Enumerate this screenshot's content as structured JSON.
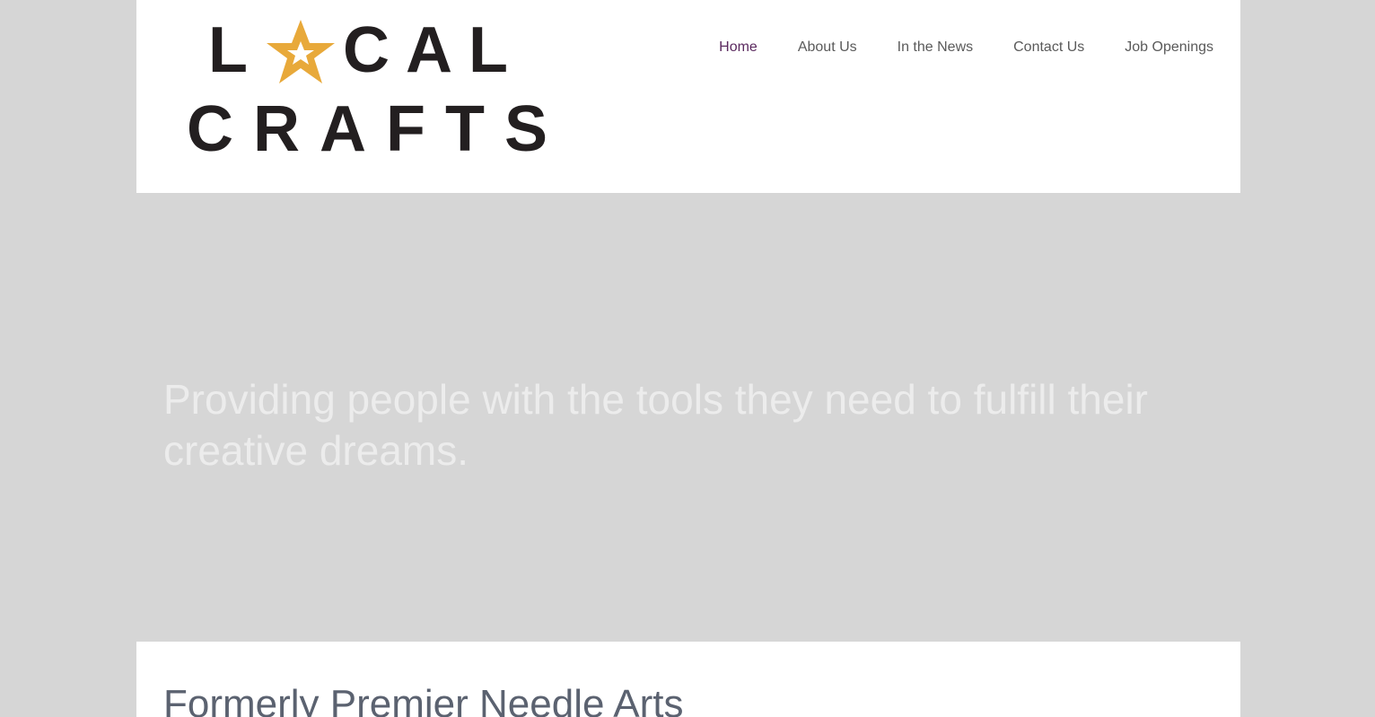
{
  "header": {
    "logo": {
      "line1_prefix": "L",
      "line1_suffix": "CAL",
      "line2": "CRAFTS",
      "star_color": "#e8a93a",
      "text_color": "#231f20",
      "icon": "star-icon"
    },
    "nav": [
      {
        "label": "Home",
        "active": true
      },
      {
        "label": "About Us",
        "active": false
      },
      {
        "label": "In the News",
        "active": false
      },
      {
        "label": "Contact Us",
        "active": false
      },
      {
        "label": "Job Openings",
        "active": false
      }
    ]
  },
  "hero": {
    "tagline": "Providing people with the tools they need to fulfill their creative dreams."
  },
  "content": {
    "heading": "Formerly Premier Needle Arts"
  },
  "colors": {
    "background": "#d6d6d6",
    "nav_active": "#5b2a5f",
    "nav_text": "#5a5a5a",
    "hero_text": "#ececec",
    "heading_text": "#5b6270"
  }
}
